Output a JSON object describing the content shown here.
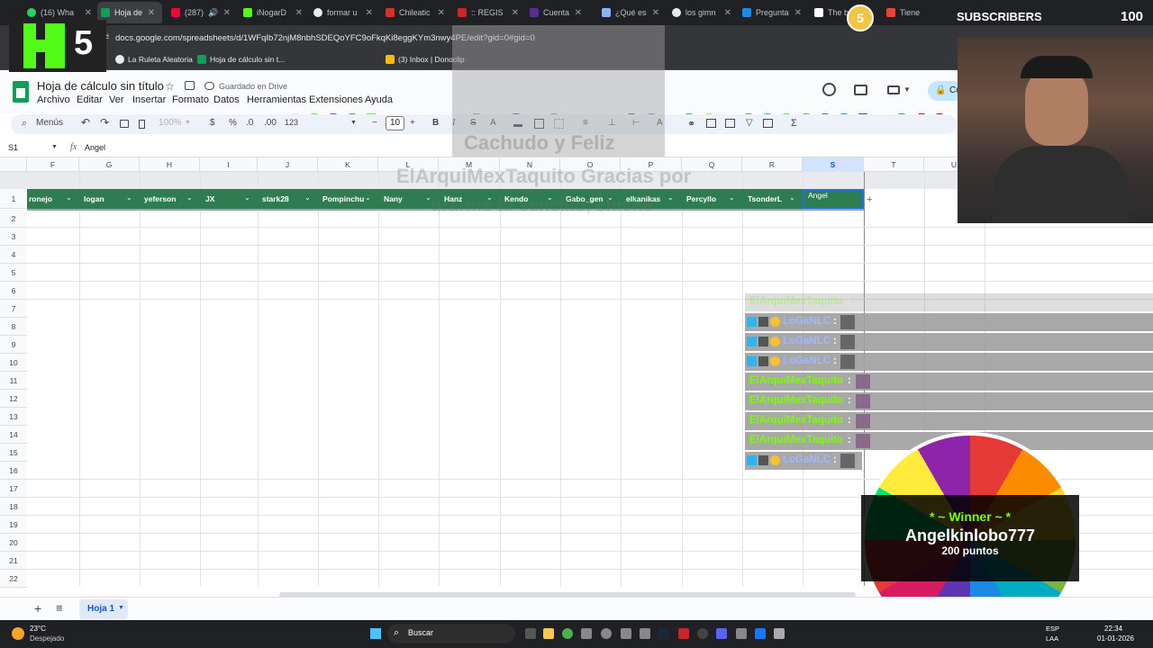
{
  "browser": {
    "tabs": [
      {
        "label": "(16) Wha"
      },
      {
        "label": "Hoja de"
      },
      {
        "label": "(287)"
      },
      {
        "label": "iNogarD"
      },
      {
        "label": "formar u"
      },
      {
        "label": "Chileatic"
      },
      {
        "label": ":: REGIS"
      },
      {
        "label": "Cuenta"
      },
      {
        "label": "¿Qué es"
      },
      {
        "label": "los gimn"
      },
      {
        "label": "Pregunta"
      },
      {
        "label": "The b"
      },
      {
        "label": "Tiene"
      }
    ],
    "url": "docs.google.com/spreadsheets/d/1WFqIb72njM8nbhSDEQoYFC9oFkqKi8eggKYm3nwy4PE/edit?gid=0#gid=0",
    "bookmarks": [
      {
        "label": "La Ruleta Aleatoria"
      },
      {
        "label": "Hoja de cálculo sin t..."
      },
      {
        "label": "(3) Inbox | Donoclip"
      }
    ]
  },
  "sheets": {
    "title": "Hoja de cálculo sin título",
    "saved_status": "Guardado en Drive",
    "menus": [
      "Archivo",
      "Editar",
      "Ver",
      "Insertar",
      "Formato",
      "Datos",
      "Herramientas",
      "Extensiones",
      "Ayuda"
    ],
    "share_label": "Co",
    "toolbar": {
      "search_label": "Menús",
      "zoom": "100%",
      "currency": "$",
      "percent": "%",
      "dec_decrease": ".0",
      "dec_increase": ".00",
      "number_format": "123",
      "font_size": "10"
    },
    "name_box": "S1",
    "formula_value": "Angel",
    "columns": [
      "F",
      "G",
      "H",
      "I",
      "J",
      "K",
      "L",
      "M",
      "N",
      "O",
      "P",
      "Q",
      "R",
      "S",
      "T",
      "U"
    ],
    "row_numbers": [
      "1",
      "2",
      "3",
      "4",
      "5",
      "6",
      "7",
      "8",
      "9",
      "10",
      "11",
      "12",
      "13",
      "14",
      "15",
      "16",
      "17",
      "18",
      "19",
      "20",
      "21",
      "22"
    ],
    "header_cells": [
      "ronejo",
      "logan",
      "yeferson",
      "JX",
      "stark28",
      "Pompinchu",
      "Nany",
      "Hanz",
      "Kendo",
      "Gabo_gen",
      "elkanikas",
      "Percyllo",
      "TsonderL",
      "Angel"
    ],
    "sheet_tab": "Hoja 1"
  },
  "overlays": {
    "logo_text": "5",
    "subscribers_label": "SUBSCRIBERS",
    "subscribers_count": "100",
    "subscribers_badge": "5",
    "ghost_text_1": "Cachudo y Feliz",
    "ghost_text_2": "ElArquiMexTaquito Gracias por",
    "ghost_text_3": "tirarme tu sencillo, chiche",
    "chat": [
      {
        "name": "ElArquiMexTaquito",
        "suffix": ":",
        "faded": true
      },
      {
        "name": "LoGaNLC",
        "suffix": ":"
      },
      {
        "name": "LoGaNLC",
        "suffix": ":"
      },
      {
        "name": "LoGaNLC",
        "suffix": ":"
      },
      {
        "name": "ElArquiMexTaquito",
        "suffix": ":"
      },
      {
        "name": "ElArquiMexTaquito",
        "suffix": ":"
      },
      {
        "name": "ElArquiMexTaquito",
        "suffix": ":"
      },
      {
        "name": "ElArquiMexTaquito",
        "suffix": ":"
      },
      {
        "name": "LoGaNLC",
        "suffix": ":"
      }
    ],
    "winner_label": "* ~ Winner ~ *",
    "winner_name": "Angelkinlobo777",
    "winner_points": "200 puntos"
  },
  "taskbar": {
    "weather_temp": "23°C",
    "weather_desc": "Despejado",
    "search_label": "Buscar",
    "lang": "ESP",
    "lang_sub": "LAA",
    "time": "22:34",
    "date": "01-01-2026"
  },
  "colors": {
    "header_green": "#2e7d52",
    "accent_blue": "#1a73e8",
    "chat_green": "#7CFC00",
    "chat_blue": "#9fb8ff"
  }
}
